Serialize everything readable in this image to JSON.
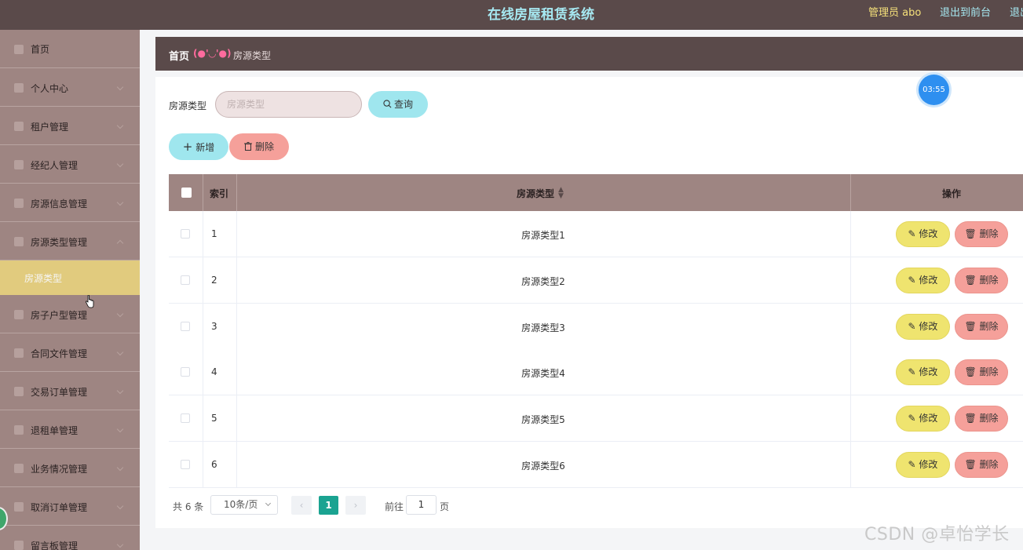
{
  "header": {
    "title": "在线房屋租赁系统",
    "admin": "管理员 abo",
    "link_frontend": "退出到前台",
    "link_logout": "退出"
  },
  "sidebar": {
    "items": [
      {
        "label": "首页",
        "icon": "home-icon"
      },
      {
        "label": "个人中心",
        "icon": "user-icon"
      },
      {
        "label": "租户管理",
        "icon": "tenant-icon"
      },
      {
        "label": "经纪人管理",
        "icon": "agent-icon"
      },
      {
        "label": "房源信息管理",
        "icon": "house-info-icon"
      },
      {
        "label": "房源类型管理",
        "icon": "house-type-icon"
      },
      {
        "label": "房子户型管理",
        "icon": "layout-icon"
      },
      {
        "label": "合同文件管理",
        "icon": "contract-icon"
      },
      {
        "label": "交易订单管理",
        "icon": "order-icon"
      },
      {
        "label": "退租单管理",
        "icon": "refund-icon"
      },
      {
        "label": "业务情况管理",
        "icon": "business-icon"
      },
      {
        "label": "取消订单管理",
        "icon": "cancel-order-icon"
      },
      {
        "label": "留言板管理",
        "icon": "message-icon"
      }
    ],
    "active_sub": "房源类型"
  },
  "breadcrumb": {
    "home": "首页",
    "face": "(●'◡'●)",
    "current": "房源类型"
  },
  "search": {
    "label": "房源类型",
    "placeholder": "房源类型",
    "query_button": "查询"
  },
  "actions": {
    "add": "新增",
    "delete": "删除"
  },
  "table": {
    "columns": {
      "index": "索引",
      "type": "房源类型",
      "ops": "操作"
    },
    "rows": [
      {
        "index": "1",
        "type": "房源类型1"
      },
      {
        "index": "2",
        "type": "房源类型2"
      },
      {
        "index": "3",
        "type": "房源类型3"
      },
      {
        "index": "4",
        "type": "房源类型4"
      },
      {
        "index": "5",
        "type": "房源类型5"
      },
      {
        "index": "6",
        "type": "房源类型6"
      }
    ],
    "edit_label": "修改",
    "delete_label": "删除"
  },
  "pagination": {
    "total": "共 6 条",
    "page_size": "10条/页",
    "current": "1",
    "goto_prefix": "前往",
    "goto_value": "1",
    "goto_suffix": "页"
  },
  "timer": "03:55",
  "watermark": "CSDN @卓怡学长",
  "colors": {
    "header_bg": "#5a4a4a",
    "sidebar_bg": "#9e8582",
    "active_sub_bg": "#e1cb7e",
    "cyan_button": "#9fe6ee",
    "red_button": "#f5a09a",
    "yellow_button": "#efe46f",
    "page_active": "#1aa391"
  }
}
